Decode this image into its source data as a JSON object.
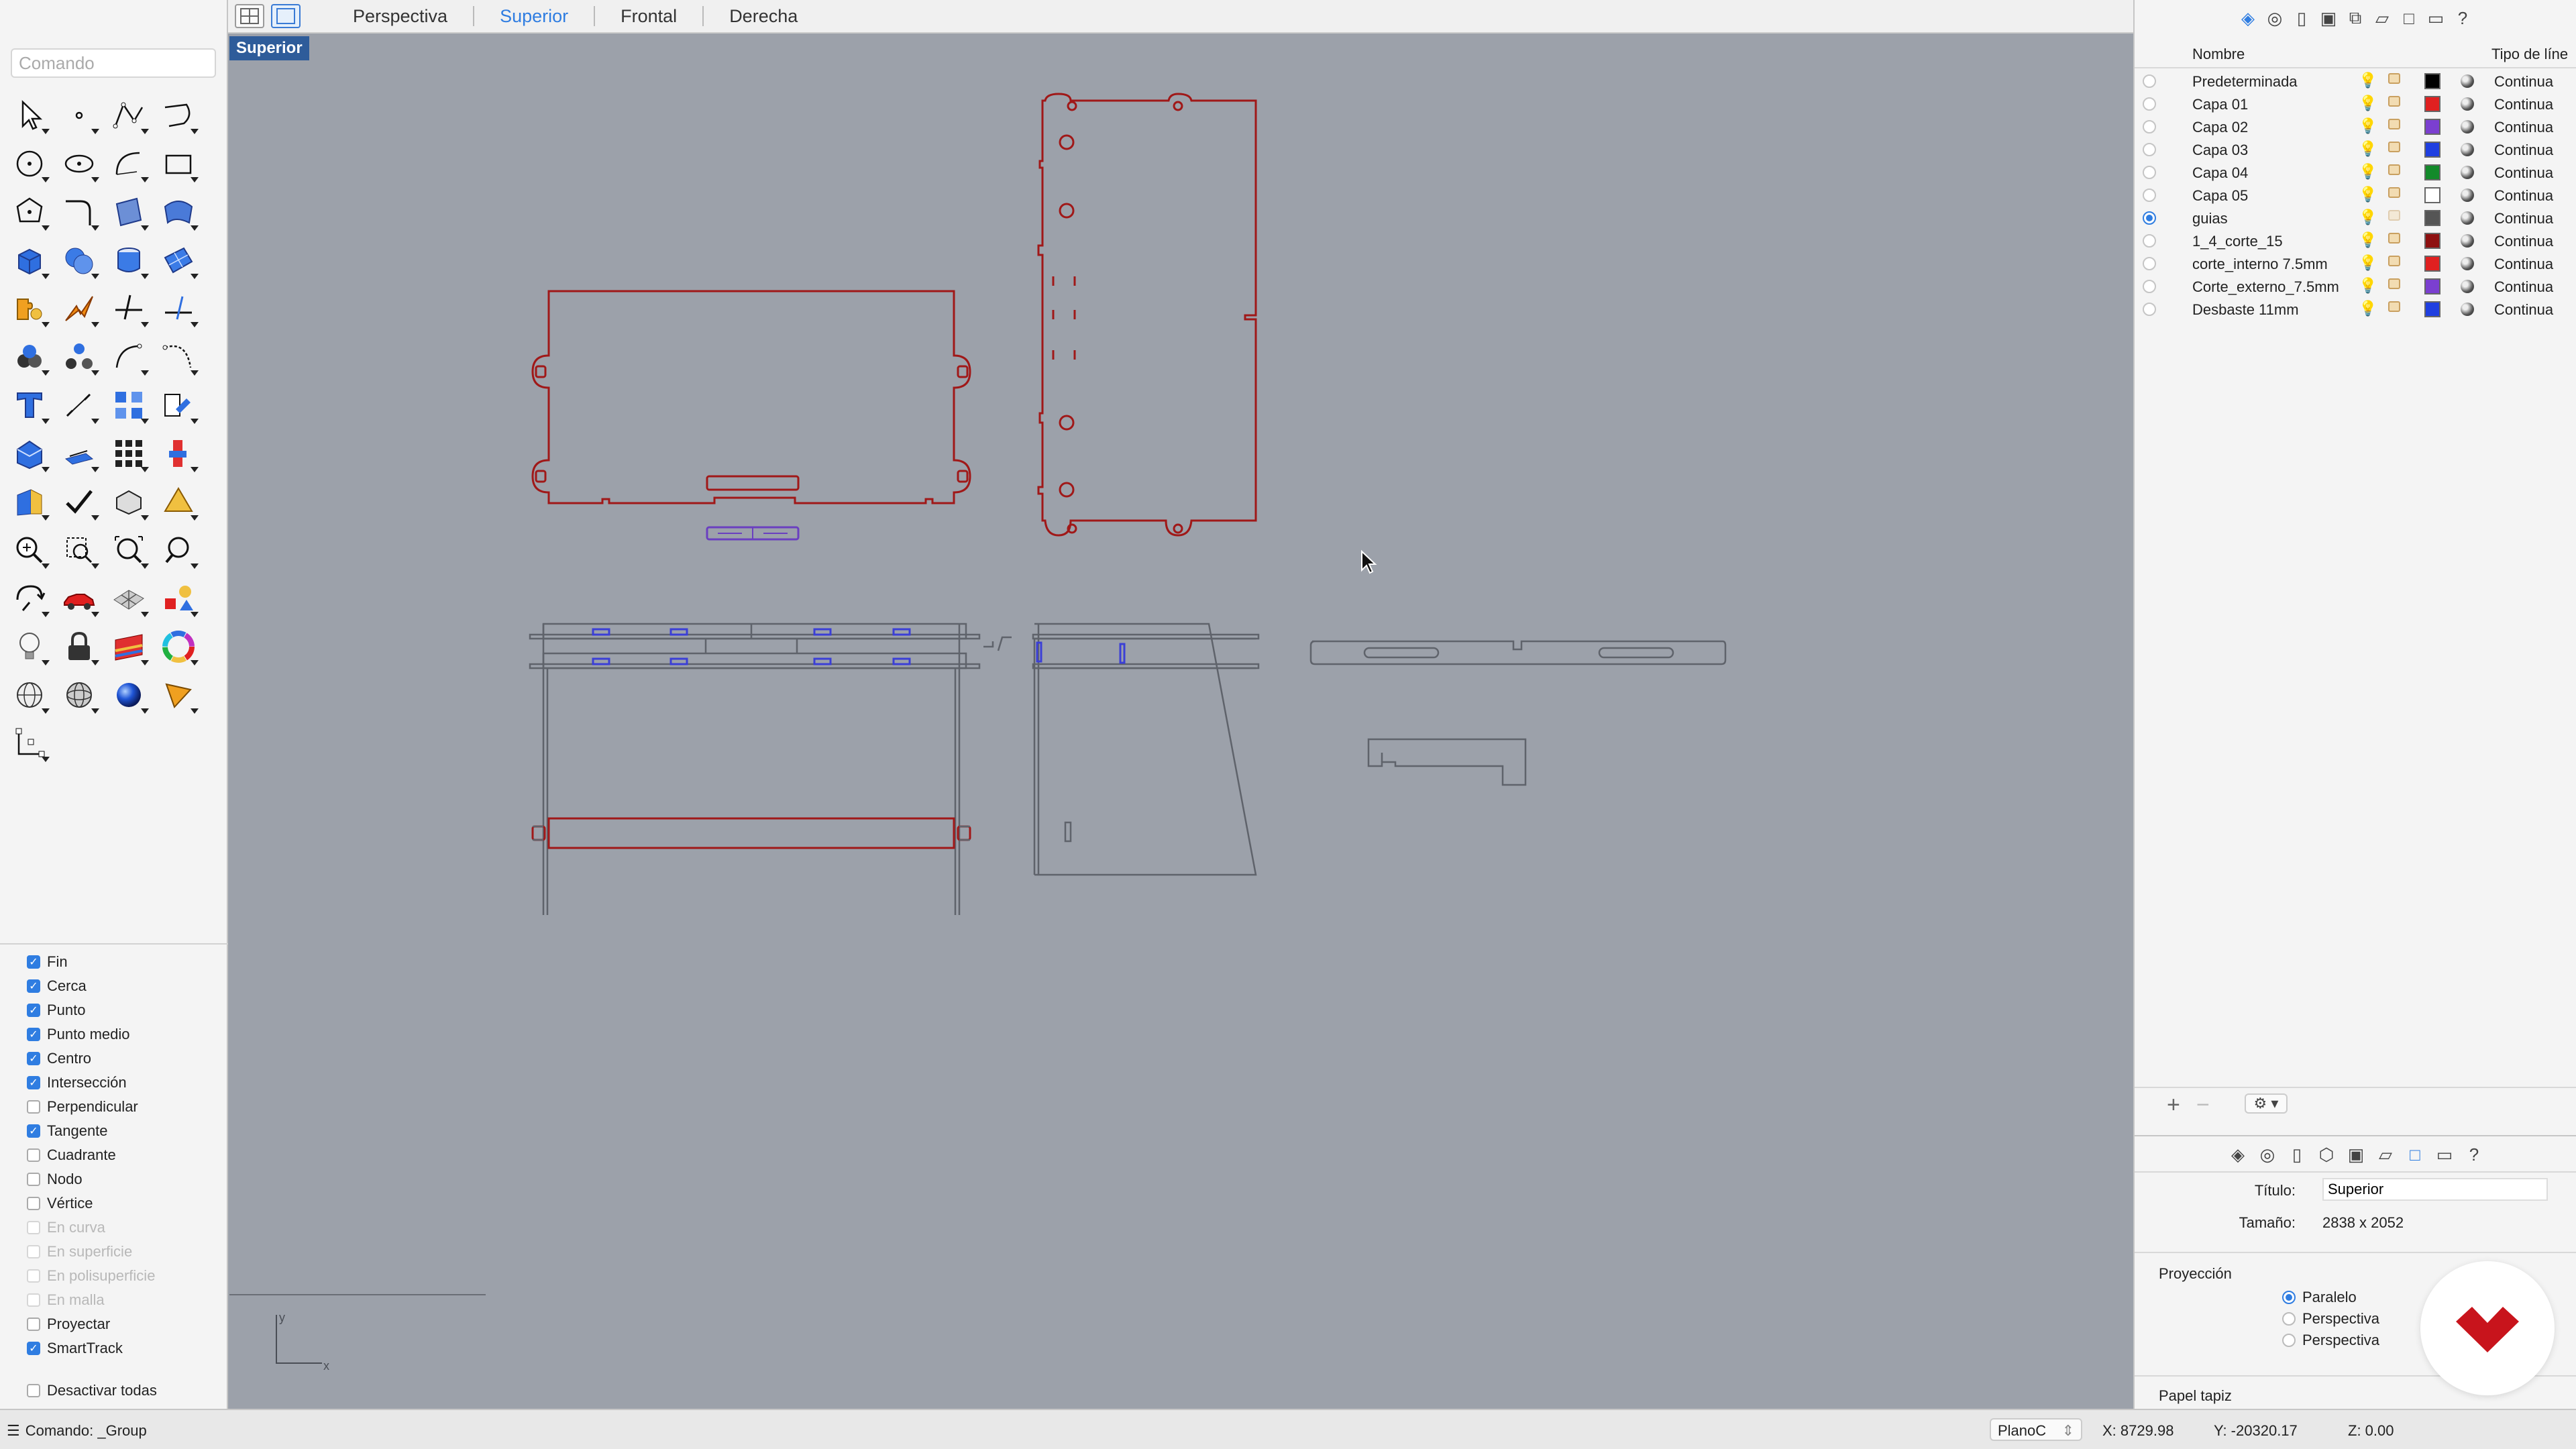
{
  "viewport_tabs": [
    "Perspectiva",
    "Superior",
    "Frontal",
    "Derecha"
  ],
  "active_tab_index": 1,
  "command": {
    "placeholder": "Comando"
  },
  "viewport": {
    "label": "Superior"
  },
  "osnaps": [
    {
      "label": "Fin",
      "checked": true
    },
    {
      "label": "Cerca",
      "checked": true
    },
    {
      "label": "Punto",
      "checked": true
    },
    {
      "label": "Punto medio",
      "checked": true
    },
    {
      "label": "Centro",
      "checked": true
    },
    {
      "label": "Intersección",
      "checked": true
    },
    {
      "label": "Perpendicular",
      "checked": false
    },
    {
      "label": "Tangente",
      "checked": true
    },
    {
      "label": "Cuadrante",
      "checked": false
    },
    {
      "label": "Nodo",
      "checked": false
    },
    {
      "label": "Vértice",
      "checked": false
    },
    {
      "label": "En curva",
      "checked": false,
      "disabled": true
    },
    {
      "label": "En superficie",
      "checked": false,
      "disabled": true
    },
    {
      "label": "En polisuperficie",
      "checked": false,
      "disabled": true
    },
    {
      "label": "En malla",
      "checked": false,
      "disabled": true
    },
    {
      "label": "Proyectar",
      "checked": false
    },
    {
      "label": "SmartTrack",
      "checked": true
    }
  ],
  "osnap_disable_all": "Desactivar todas",
  "layers": {
    "header_name": "Nombre",
    "header_type": "Tipo de líne",
    "rows": [
      {
        "name": "Predeterminada",
        "color": "#000000",
        "type": "Continua",
        "current": false,
        "on": true
      },
      {
        "name": "Capa 01",
        "color": "#e02020",
        "type": "Continua",
        "current": false,
        "on": true
      },
      {
        "name": "Capa 02",
        "color": "#7b3fd0",
        "type": "Continua",
        "current": false,
        "on": true
      },
      {
        "name": "Capa 03",
        "color": "#1f3fe0",
        "type": "Continua",
        "current": false,
        "on": true
      },
      {
        "name": "Capa 04",
        "color": "#138a2a",
        "type": "Continua",
        "current": false,
        "on": true
      },
      {
        "name": "Capa 05",
        "color": "#ffffff",
        "type": "Continua",
        "current": false,
        "on": true
      },
      {
        "name": "guias",
        "color": "#555555",
        "type": "Continua",
        "current": true,
        "on": false
      },
      {
        "name": "1_4_corte_15",
        "color": "#8e1010",
        "type": "Continua",
        "current": false,
        "on": true
      },
      {
        "name": "corte_interno 7.5mm",
        "color": "#e02020",
        "type": "Continua",
        "current": false,
        "on": true
      },
      {
        "name": "Corte_externo_7.5mm",
        "color": "#7b3fd0",
        "type": "Continua",
        "current": false,
        "on": true
      },
      {
        "name": "Desbaste 11mm",
        "color": "#1f3fe0",
        "type": "Continua",
        "current": false,
        "on": true
      }
    ]
  },
  "properties": {
    "title_label": "Título:",
    "title_value": "Superior",
    "size_label": "Tamaño:",
    "size_value": "2838 x 2052",
    "projection_title": "Proyección",
    "projection_options": [
      {
        "label": "Paralelo",
        "selected": true
      },
      {
        "label": "Perspectiva",
        "selected": false
      },
      {
        "label": "Perspectiva",
        "selected": false
      }
    ],
    "wallpaper": "Papel tapiz"
  },
  "status": {
    "command": "Comando: _Group",
    "plane": "PlanoC",
    "x": "X: 8729.98",
    "y": "Y: -20320.17",
    "z": "Z: 0.00"
  },
  "colors": {
    "viewport_bg": "#9ca1aa",
    "cut_red": "#a01818",
    "inner_blue": "#3b3fd6",
    "guide_gray": "#5f636b",
    "accent": "#2f7de1"
  },
  "axis": {
    "x": "x",
    "y": "y"
  }
}
